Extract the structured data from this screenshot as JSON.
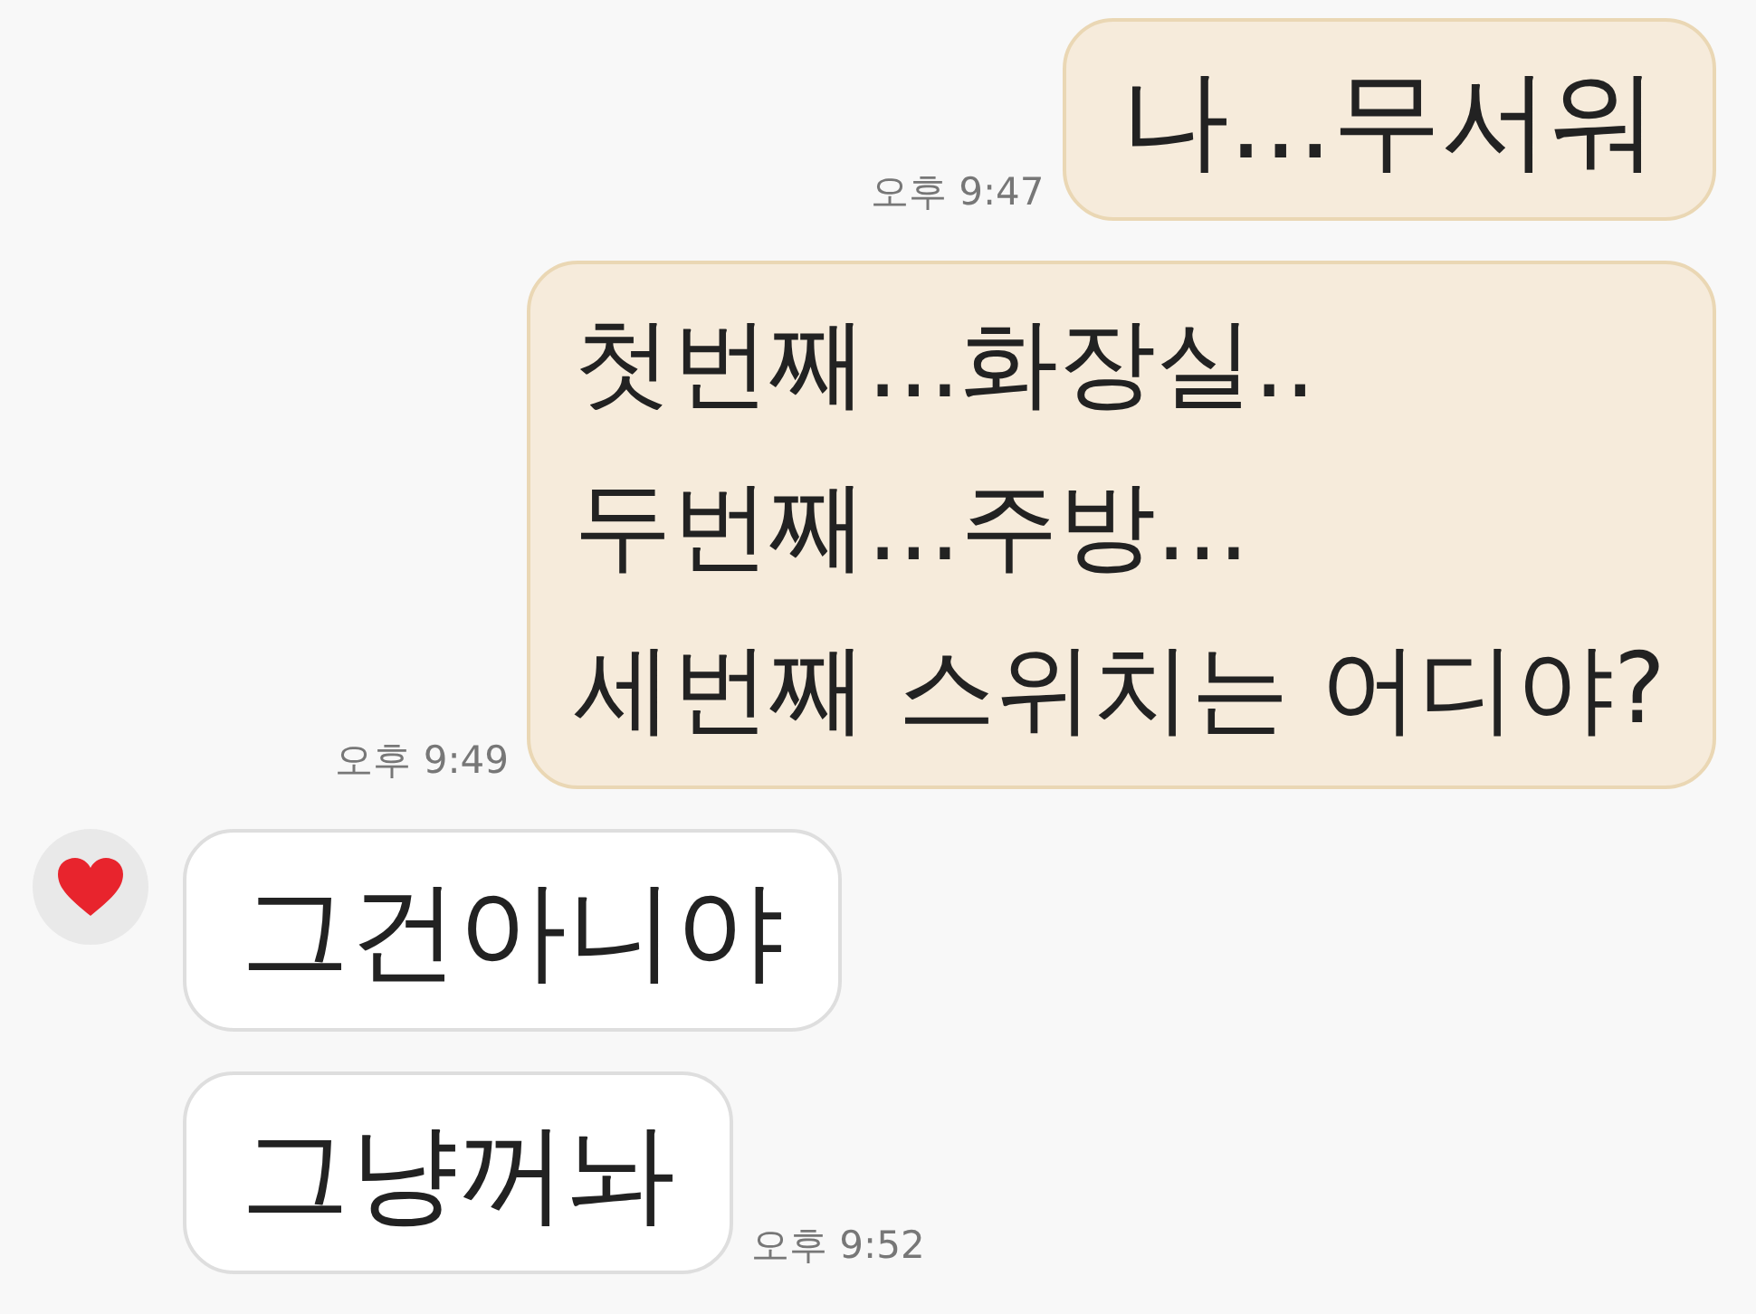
{
  "messages": [
    {
      "kind": "sent",
      "lines": [
        "나...무서워"
      ],
      "time": "오후 9:47"
    },
    {
      "kind": "sent",
      "lines": [
        "첫번째...화장실..",
        "두번째...주방...",
        "세번째 스위치는 어디야?"
      ],
      "time": "오후 9:49"
    },
    {
      "kind": "received",
      "avatar": true,
      "lines": [
        "그건아니야"
      ]
    },
    {
      "kind": "received",
      "avatar": false,
      "lines": [
        "그냥꺼놔"
      ],
      "time": "오후 9:52"
    }
  ]
}
